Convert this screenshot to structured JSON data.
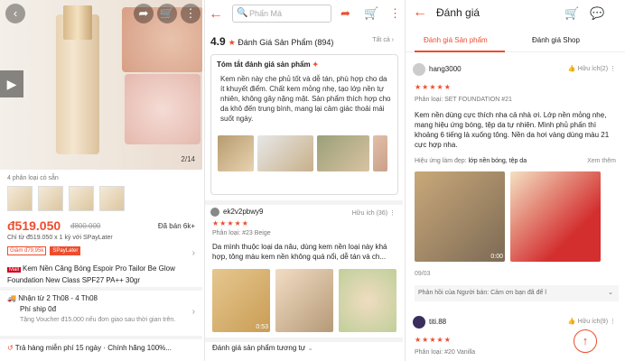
{
  "panel1": {
    "image_counter": "2/14",
    "variants_label": "4 phân loại có sẵn",
    "price": "đ519.050",
    "old_price": "đ800.000",
    "sold": "Đã bán 6k+",
    "installment": "Chỉ từ đ519.050 x 1 kỳ với SPayLater",
    "tag_discount": "Giảm đ79,95k",
    "tag_spaylater": "SPayLater",
    "mall_badge": "Mall",
    "product_name": "Kem Nền Căng Bóng Espoir Pro Tailor Be Glow Foundation New Class SPF27 PA++ 30gr",
    "delivery": "Nhận từ 2 Th08 - 4 Th08",
    "shipping_fee": "Phí ship 0đ",
    "voucher_note": "Tặng Voucher đ15.000 nếu đơn giao sau thời gian trên.",
    "return_policy": "Trả hàng miễn phí 15 ngày · Chính hãng 100%..."
  },
  "panel2": {
    "search_placeholder": "Phấn Má",
    "rating": "4.9",
    "rating_label": "Đánh Giá Sản Phẩm (894)",
    "see_all": "Tất cả",
    "summary_title": "Tóm tắt đánh giá sản phẩm",
    "summary_text": "Kem nền này che phủ tốt và dễ tán, phù hợp cho da ít khuyết điểm. Chất kem mỏng nhẹ, tạo lớp nền tự nhiên, không gây nặng mặt. Sản phẩm thích hợp cho da khô đến trung bình, mang lại cảm giác thoải mái suốt ngày.",
    "reviewer": "ek2v2pbwy9",
    "helpful": "Hữu ích (36)",
    "stars": "★★★★★",
    "variant": "Phân loại: #23 Beige",
    "review_text": "Da mình thuộc loại da nâu, dùng kem nền loại này khá hợp, tông màu kem nền không quá nổi, dễ tán và ch...",
    "video_duration": "0:53",
    "similar_reviews": "Đánh giá sản phẩm tương tự"
  },
  "panel3": {
    "title": "Đánh giá",
    "tab_product": "Đánh giá Sản phẩm",
    "tab_shop": "Đánh giá Shop",
    "reviewer": "hang3000",
    "helpful": "Hữu ích(2)",
    "stars": "★★★★★",
    "variant": "Phân loại: SET FOUNDATION #21",
    "review_text": "Kem nền dùng cực thích nha cả nhà ơi. Lớp nền mỏng nhẹ, mang hiệu ứng bóng, tệp da tự nhiên. Mình phủ phấn thì khoảng 6 tiếng là xuống tông. Nền da hơi vàng dùng màu 21 cực hợp nha.",
    "effect_label": "Hiệu ứng làm đẹp:",
    "effect_value": "lớp nền bóng, tệp da",
    "see_more": "Xem thêm",
    "video_duration": "0:00",
    "date": "09/03",
    "seller_reply": "Phản hồi của Người bán: Cảm ơn bạn đã để l",
    "reviewer2": "titi.88",
    "helpful2": "Hữu ích(9)",
    "variant2": "Phân loại: #20 Vanilla"
  }
}
